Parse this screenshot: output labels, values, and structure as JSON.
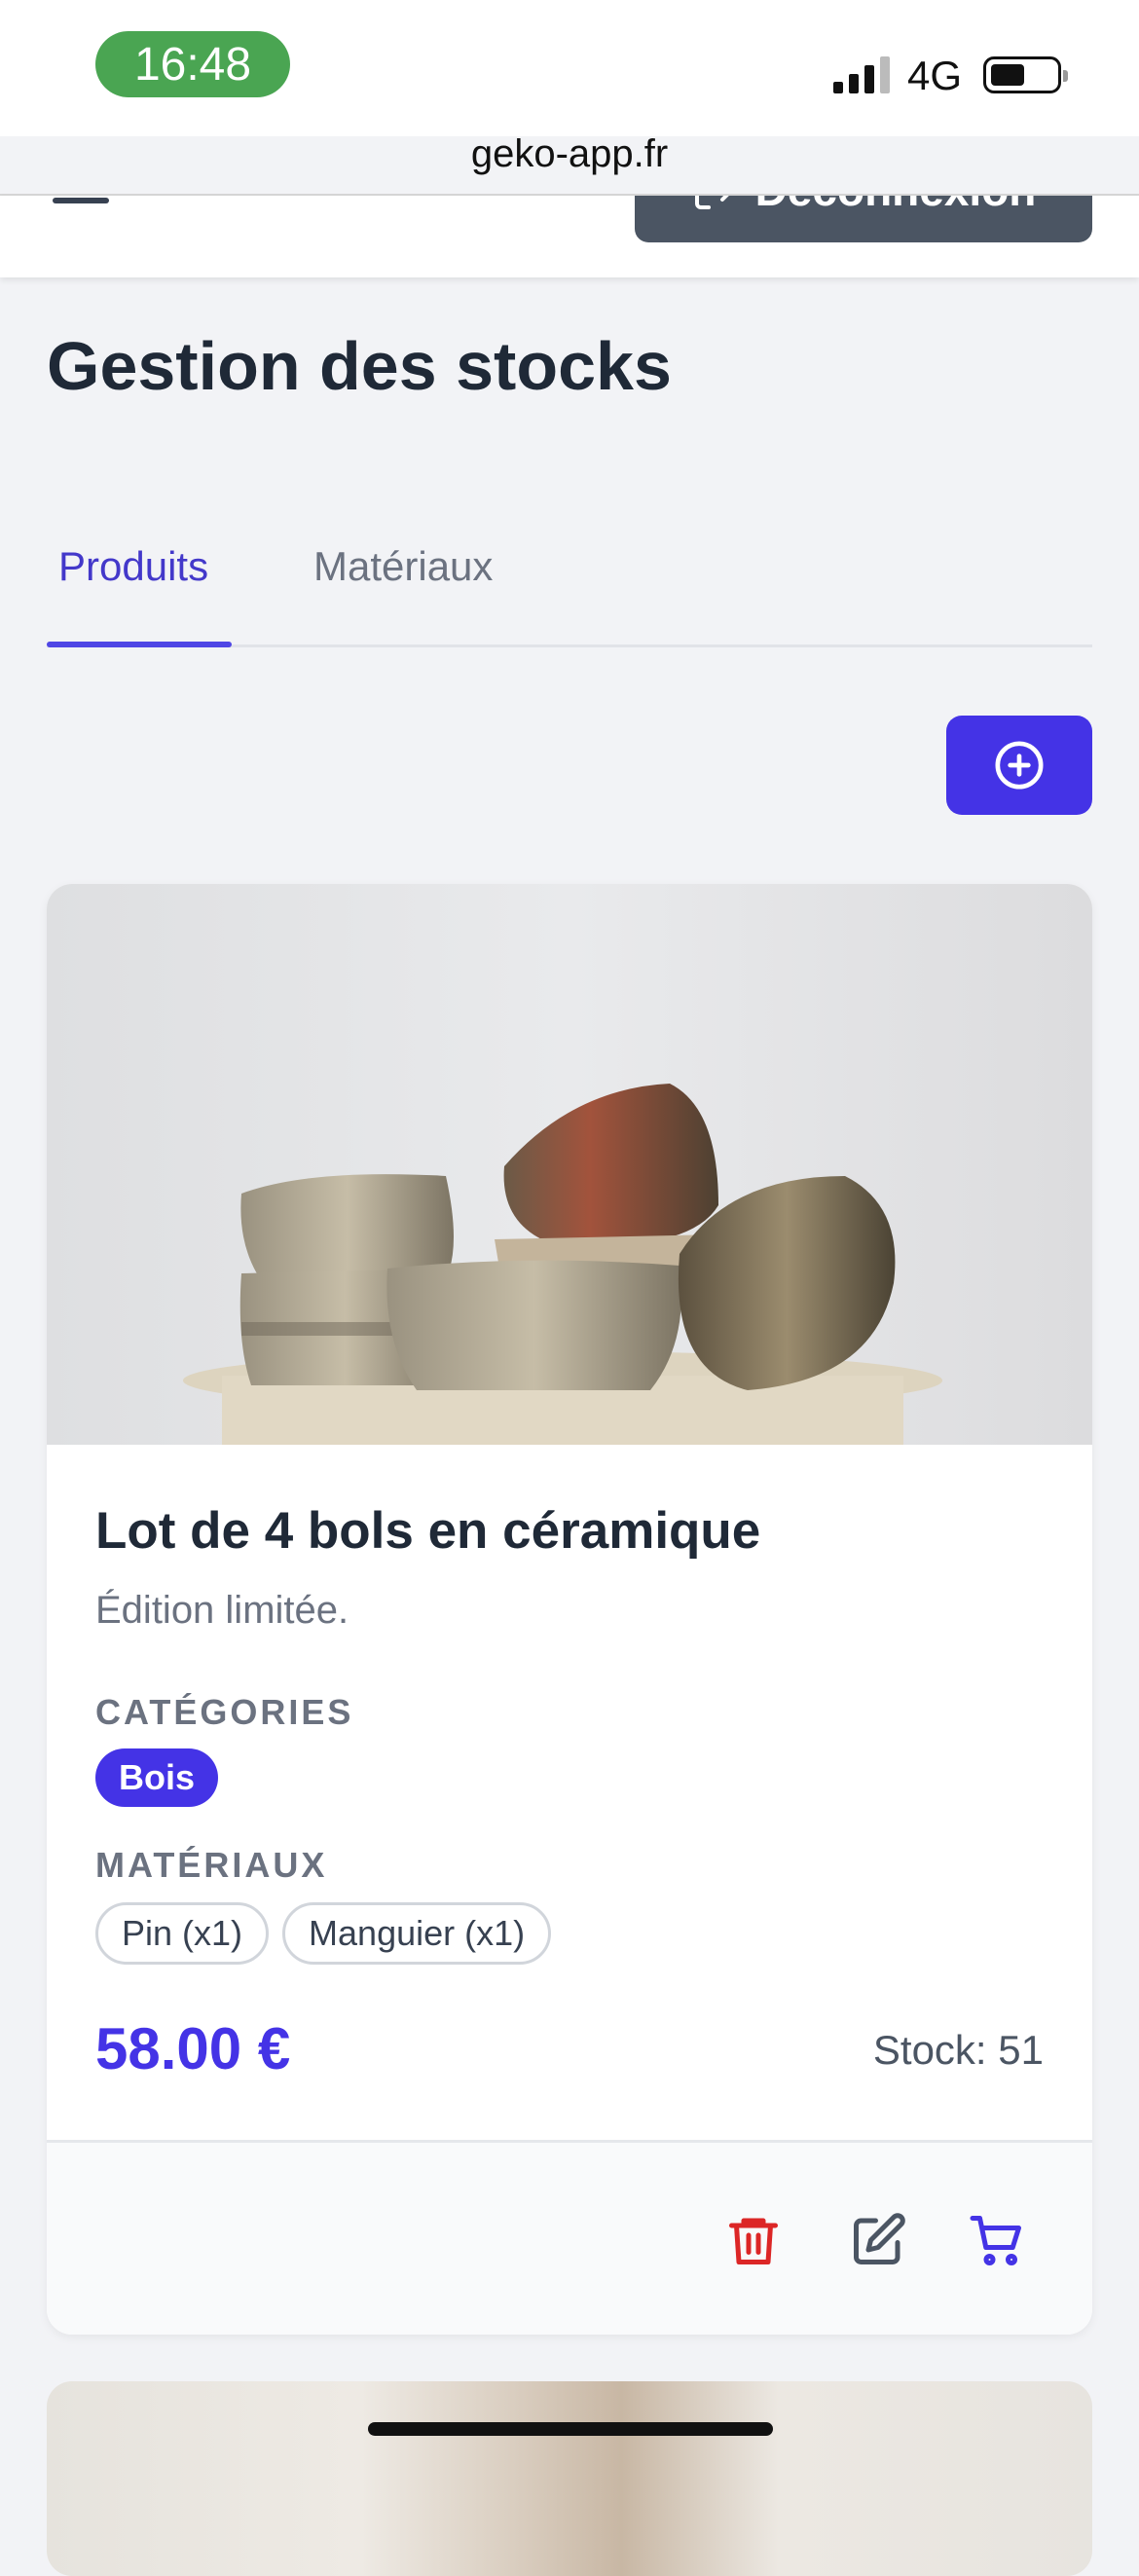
{
  "status_bar": {
    "time": "16:48",
    "network": "4G"
  },
  "browser": {
    "url": "geko-app.fr"
  },
  "nav": {
    "logout_label": "Déconnexion"
  },
  "page": {
    "title": "Gestion des stocks"
  },
  "tabs": [
    {
      "label": "Produits",
      "active": true
    },
    {
      "label": "Matériaux",
      "active": false
    }
  ],
  "product": {
    "name": "Lot de 4 bols en céramique",
    "description": "Édition limitée.",
    "categories_label": "CATÉGORIES",
    "categories": [
      "Bois"
    ],
    "materials_label": "MATÉRIAUX",
    "materials": [
      "Pin (x1)",
      "Manguier (x1)"
    ],
    "price": "58.00 €",
    "stock": "Stock: 51"
  },
  "colors": {
    "accent": "#4433e6",
    "delete": "#dc2626",
    "status_pill": "#4aa552",
    "logout_bg": "#4b5563"
  }
}
